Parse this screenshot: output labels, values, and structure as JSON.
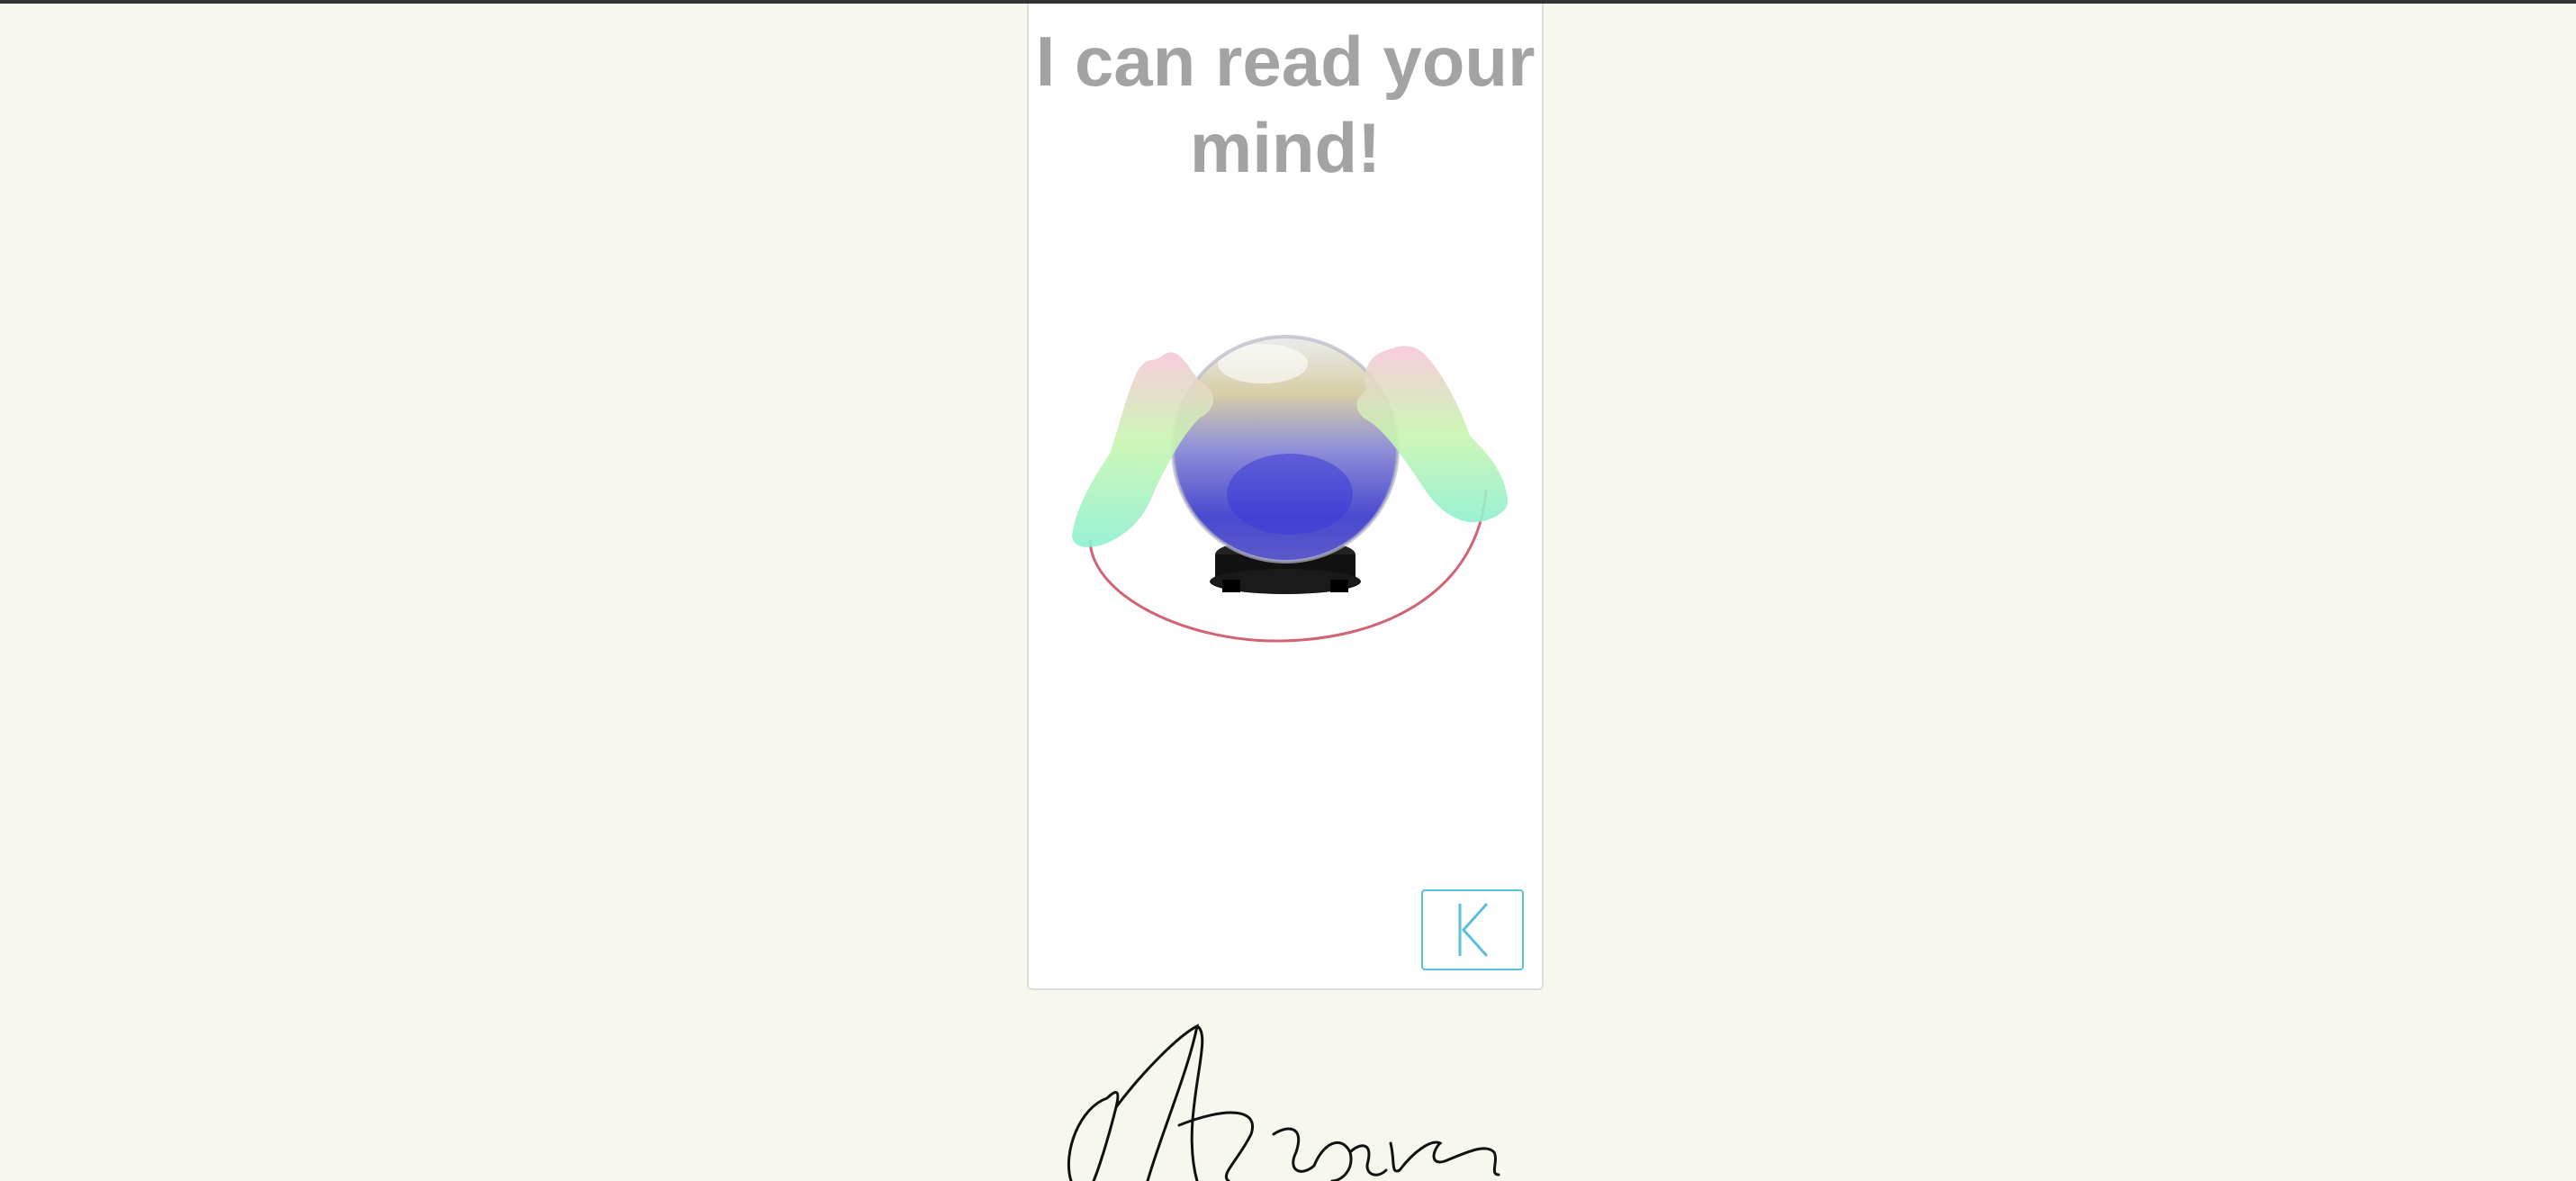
{
  "card": {
    "title": "I can read your mind!"
  },
  "illustration": {
    "icon": "crystal-ball-with-hands-illustration"
  },
  "reset_button": {
    "icon": "skip-back-icon",
    "accent_color": "#5bc0de"
  },
  "footer": {
    "signature_text": "Marquise",
    "icon": "handwritten-signature-logo"
  },
  "colors": {
    "background": "#f7f7f0",
    "title": "#a3a3a3",
    "card": "#ffffff"
  }
}
